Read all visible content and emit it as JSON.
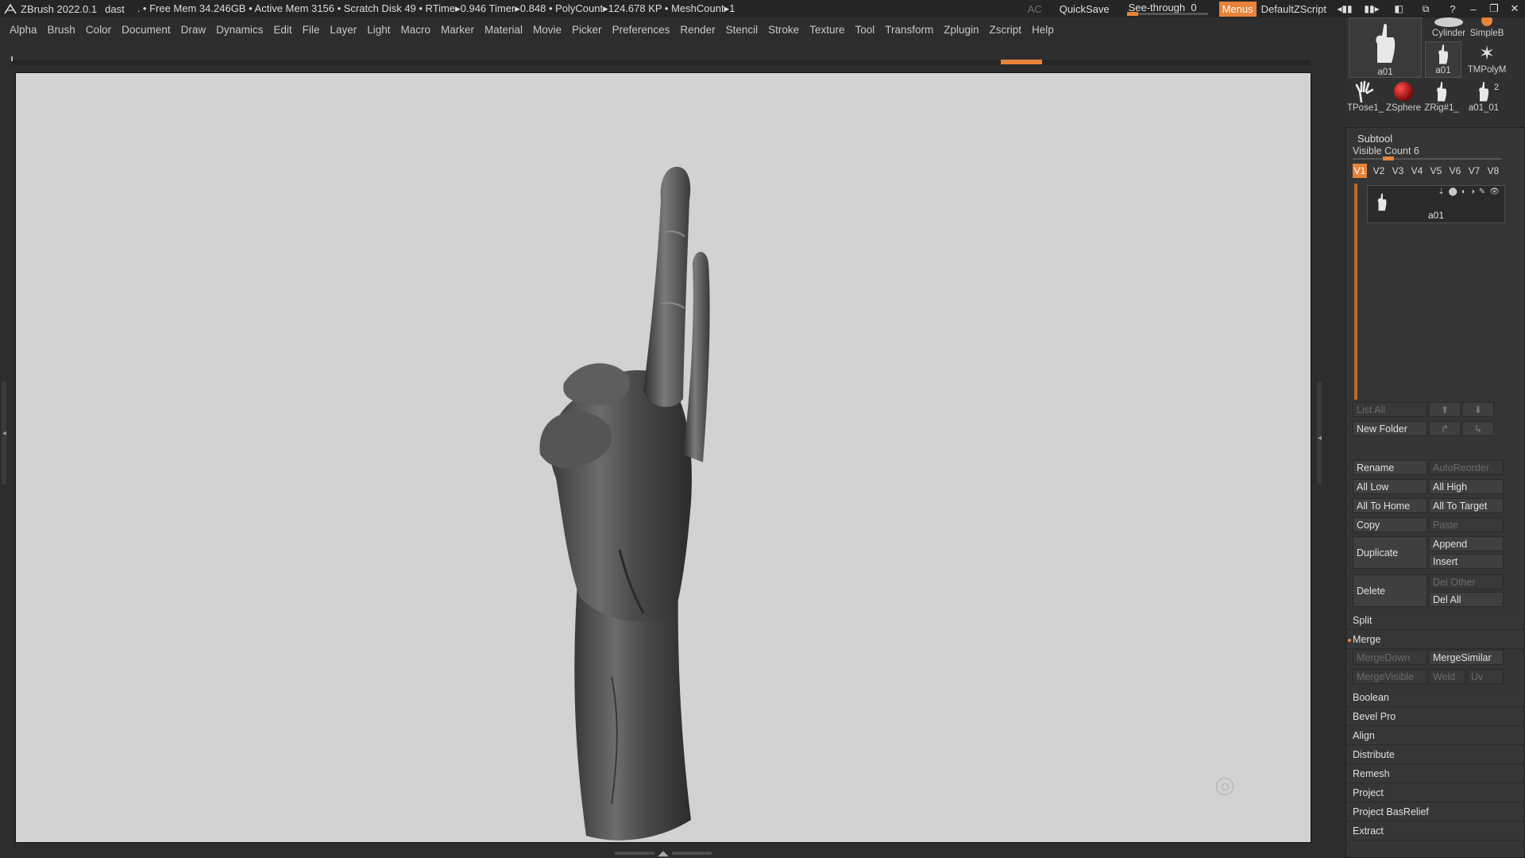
{
  "titlebar": {
    "app_name": "ZBrush 2022.0.1",
    "doc_name": "dast",
    "stats": ". • Free Mem 34.246GB • Active Mem 3156 • Scratch Disk 49 • RTime▸0.946 Timer▸0.848 • PolyCount▸124.678 KP • MeshCount▸1",
    "ac": "AC",
    "quicksave": "QuickSave",
    "see_through_label": "See-through",
    "see_through_value": "0",
    "menus": "Menus",
    "script": "DefaultZScript"
  },
  "menubar": {
    "items": [
      "Alpha",
      "Brush",
      "Color",
      "Document",
      "Draw",
      "Dynamics",
      "Edit",
      "File",
      "Layer",
      "Light",
      "Macro",
      "Marker",
      "Material",
      "Movie",
      "Picker",
      "Preferences",
      "Render",
      "Stencil",
      "Stroke",
      "Texture",
      "Tool",
      "Transform",
      "Zplugin",
      "Zscript",
      "Help"
    ]
  },
  "tool_thumbnails": {
    "items": [
      {
        "label": "a01"
      },
      {
        "label": "Cylinder"
      },
      {
        "label": "SimpleB"
      },
      {
        "label": "a01"
      },
      {
        "label": "TMPolyM"
      },
      {
        "label": "TPose1_"
      },
      {
        "label": "ZSphere"
      },
      {
        "label": "ZRig#1_"
      },
      {
        "label": "a01_01"
      }
    ],
    "badge": "2"
  },
  "subtool": {
    "title": "Subtool",
    "visible_count_label": "Visible Count",
    "visible_count_value": "6",
    "versions": [
      "V1",
      "V2",
      "V3",
      "V4",
      "V5",
      "V6",
      "V7",
      "V8"
    ],
    "active_version": "V1",
    "items": [
      {
        "name": "a01"
      }
    ]
  },
  "buttons": {
    "list_all": "List All",
    "new_folder": "New Folder",
    "rename": "Rename",
    "auto_reorder": "AutoReorder",
    "all_low": "All Low",
    "all_high": "All High",
    "all_to_home": "All To Home",
    "all_to_target": "All To Target",
    "copy": "Copy",
    "paste": "Paste",
    "duplicate": "Duplicate",
    "append": "Append",
    "insert": "Insert",
    "delete": "Delete",
    "del_other": "Del Other",
    "del_all": "Del All",
    "split": "Split",
    "merge": "Merge",
    "merge_down": "MergeDown",
    "merge_similar": "MergeSimilar",
    "merge_visible": "MergeVisible",
    "weld": "Weld",
    "uv": "Uv",
    "boolean": "Boolean",
    "bevel_pro": "Bevel Pro",
    "align": "Align",
    "distribute": "Distribute",
    "remesh": "Remesh",
    "project": "Project",
    "project_basrelief": "Project BasRelief",
    "extract": "Extract"
  },
  "colors": {
    "accent": "#e8833a",
    "canvas": "#d2d2d2",
    "panel": "#353535"
  }
}
